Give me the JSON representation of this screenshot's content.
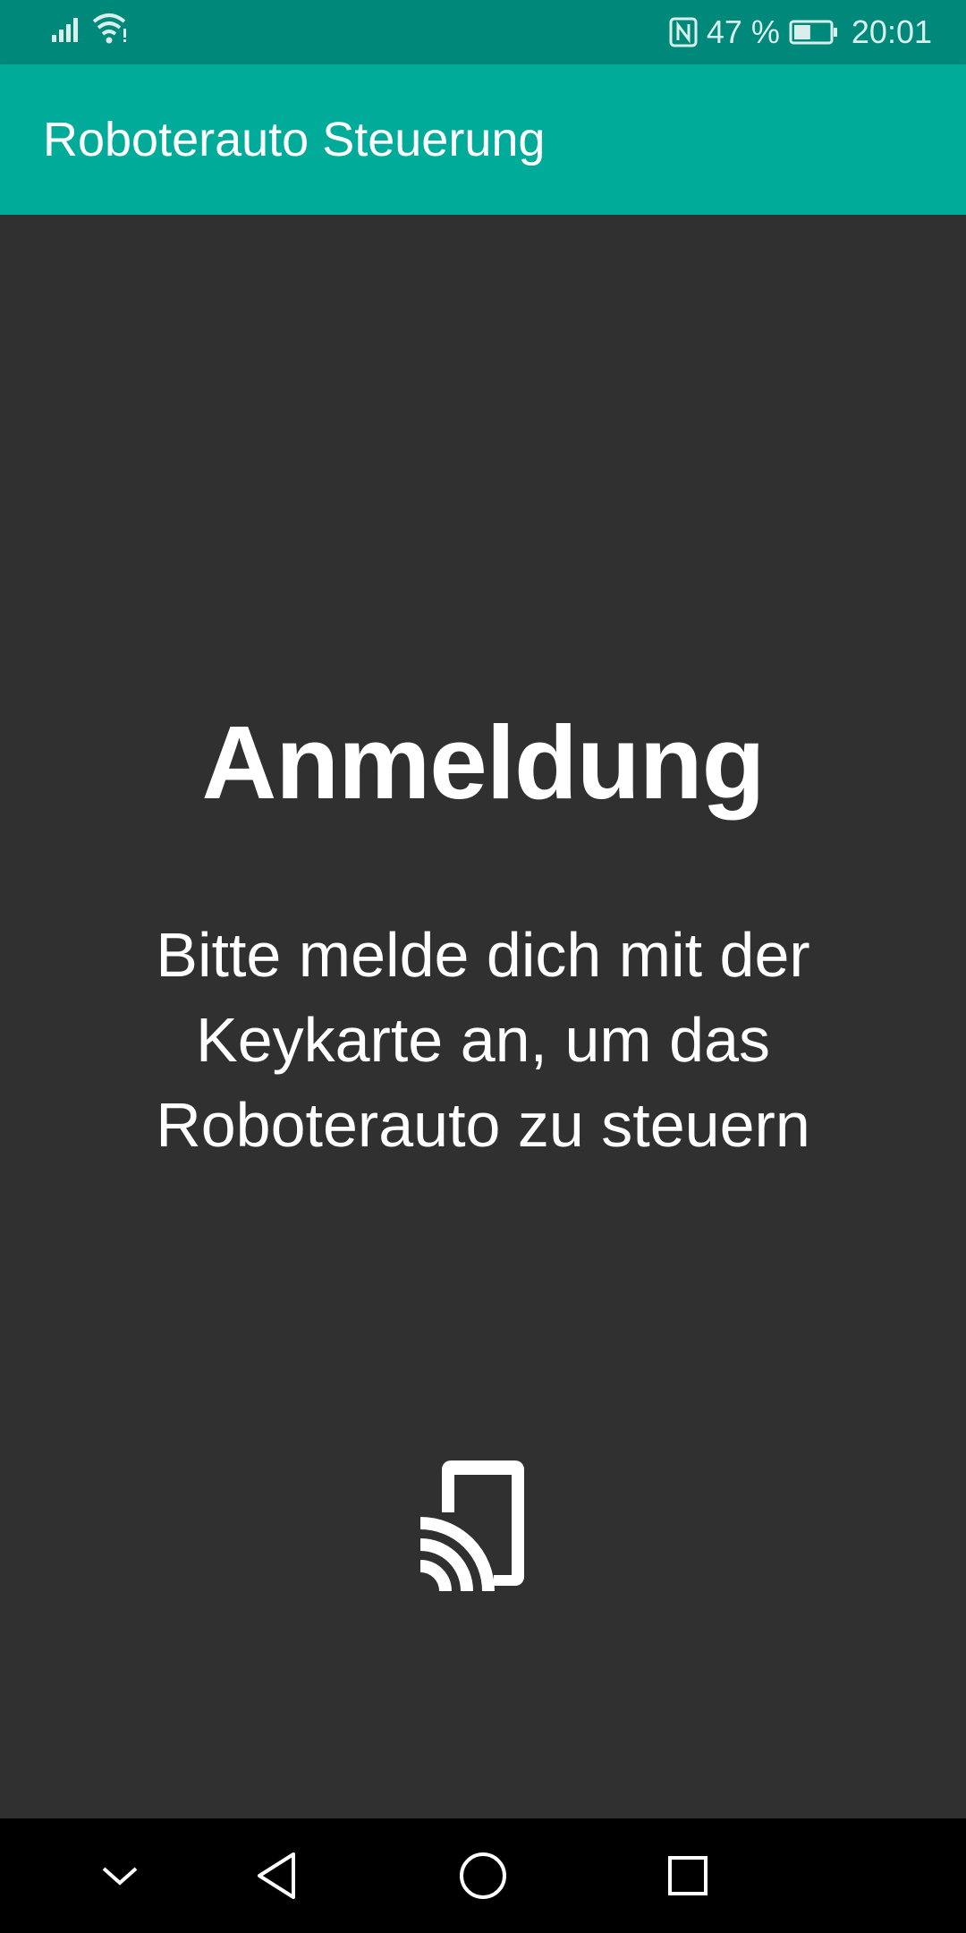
{
  "status_bar": {
    "battery_percent": "47 %",
    "time": "20:01",
    "icons": [
      "signal-icon",
      "wifi-icon",
      "nfc-icon",
      "battery-icon"
    ],
    "battery_level": 0.47
  },
  "app_bar": {
    "title": "Roboterauto Steuerung"
  },
  "main": {
    "heading": "Anmeldung",
    "message": "Bitte melde dich mit der Keykarte an, um das Roboterauto zu steuern",
    "icon": "nfc-tap-phone-icon"
  },
  "nav_bar": {
    "buttons": [
      "hide-keyboard-icon",
      "back-icon",
      "home-icon",
      "recents-icon"
    ]
  },
  "colors": {
    "status_bar": "#00897b",
    "app_bar": "#00ab99",
    "background": "#303030",
    "nav_bar": "#000000"
  }
}
